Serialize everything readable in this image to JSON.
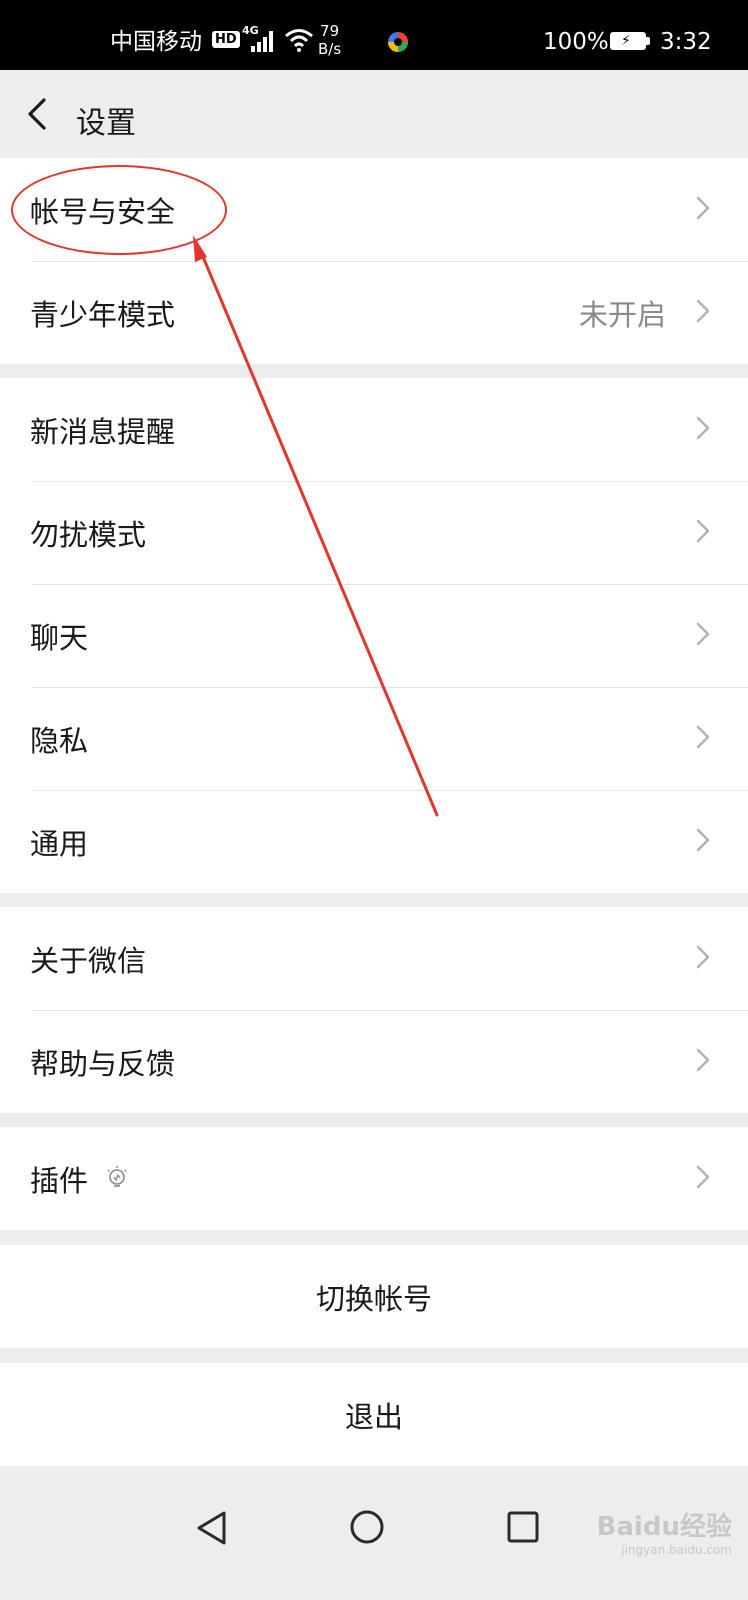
{
  "status_bar": {
    "carrier": "中国移动",
    "hd_badge": "HD",
    "network": "4G",
    "speed_value": "79",
    "speed_unit": "B/s",
    "battery": "100%",
    "time": "3:32"
  },
  "header": {
    "title": "设置"
  },
  "groups": [
    {
      "items": [
        {
          "label": "帐号与安全",
          "value": ""
        },
        {
          "label": "青少年模式",
          "value": "未开启"
        }
      ]
    },
    {
      "items": [
        {
          "label": "新消息提醒"
        },
        {
          "label": "勿扰模式"
        },
        {
          "label": "聊天"
        },
        {
          "label": "隐私"
        },
        {
          "label": "通用"
        }
      ]
    },
    {
      "items": [
        {
          "label": "关于微信"
        },
        {
          "label": "帮助与反馈"
        }
      ]
    },
    {
      "items": [
        {
          "label": "插件"
        }
      ]
    }
  ],
  "actions": {
    "switch_account": "切换帐号",
    "logout": "退出"
  },
  "watermark": {
    "brand": "Baidu经验",
    "url": "jingyan.baidu.com"
  },
  "colors": {
    "annotation": "#e2362c",
    "chevron": "#b2b2b2",
    "background": "#ededed"
  }
}
